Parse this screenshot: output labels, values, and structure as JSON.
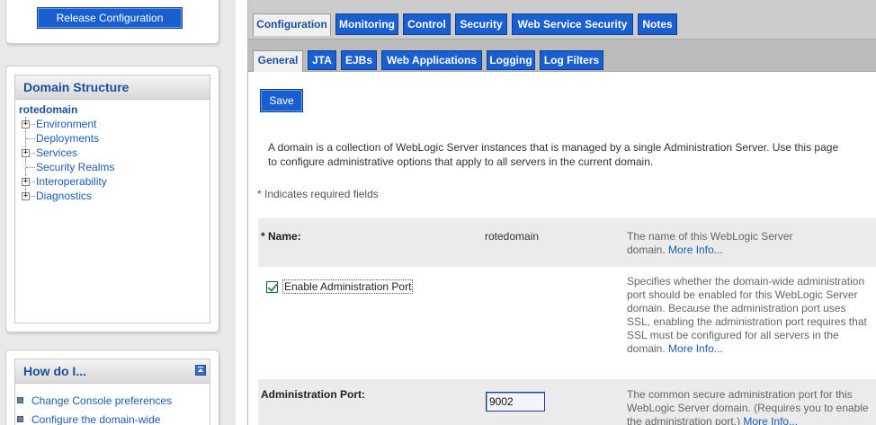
{
  "left": {
    "release_button": "Release Configuration",
    "domain_structure": {
      "title": "Domain Structure",
      "root": "rotedomain",
      "items": [
        {
          "label": "Environment",
          "expandable": true
        },
        {
          "label": "Deployments",
          "expandable": false
        },
        {
          "label": "Services",
          "expandable": true
        },
        {
          "label": "Security Realms",
          "expandable": false
        },
        {
          "label": "Interoperability",
          "expandable": true
        },
        {
          "label": "Diagnostics",
          "expandable": true
        }
      ],
      "expand_glyph": "+"
    },
    "how_do_i": {
      "title": "How do I...",
      "items": [
        "Change Console preferences",
        "Configure the domain-wide"
      ]
    }
  },
  "tabs_primary": [
    {
      "label": "Configuration",
      "active": true
    },
    {
      "label": "Monitoring",
      "active": false
    },
    {
      "label": "Control",
      "active": false
    },
    {
      "label": "Security",
      "active": false
    },
    {
      "label": "Web Service Security",
      "active": false
    },
    {
      "label": "Notes",
      "active": false
    }
  ],
  "tabs_secondary": [
    {
      "label": "General",
      "active": true
    },
    {
      "label": "JTA",
      "active": false
    },
    {
      "label": "EJBs",
      "active": false
    },
    {
      "label": "Web Applications",
      "active": false
    },
    {
      "label": "Logging",
      "active": false
    },
    {
      "label": "Log Filters",
      "active": false
    }
  ],
  "main": {
    "save_label": "Save",
    "intro_line1": "A domain is a collection of WebLogic Server instances that is managed by a single Administration Server. Use this page",
    "intro_line2": "to configure administrative options that apply to all servers in the current domain.",
    "required_note": "* Indicates required fields",
    "fields": {
      "name": {
        "required_mark": "*",
        "label": "Name:",
        "value": "rotedomain",
        "desc": "The name of this WebLogic Server domain.",
        "more": "More Info..."
      },
      "admin_port_enabled": {
        "label": "Enable Administration Port",
        "checked": true,
        "desc": "Specifies whether the domain-wide administration port should be enabled for this WebLogic Server domain. Because the administration port uses SSL, enabling the administration port requires that SSL must be configured for all servers in the domain.",
        "more": "More Info..."
      },
      "admin_port": {
        "label": "Administration Port:",
        "value": "9002",
        "desc": "The common secure administration port for this WebLogic Server domain. (Requires you to enable the administration port.)",
        "more": "More Info..."
      }
    }
  },
  "colors": {
    "button_blue": "#1a5fd0",
    "link_blue": "#1d5cb5",
    "header_blue": "#1b4f9c",
    "check_green": "#22a022"
  },
  "icons": [
    "plus-box-icon",
    "collapse-icon",
    "bullet-icon",
    "checkbox-icon"
  ]
}
